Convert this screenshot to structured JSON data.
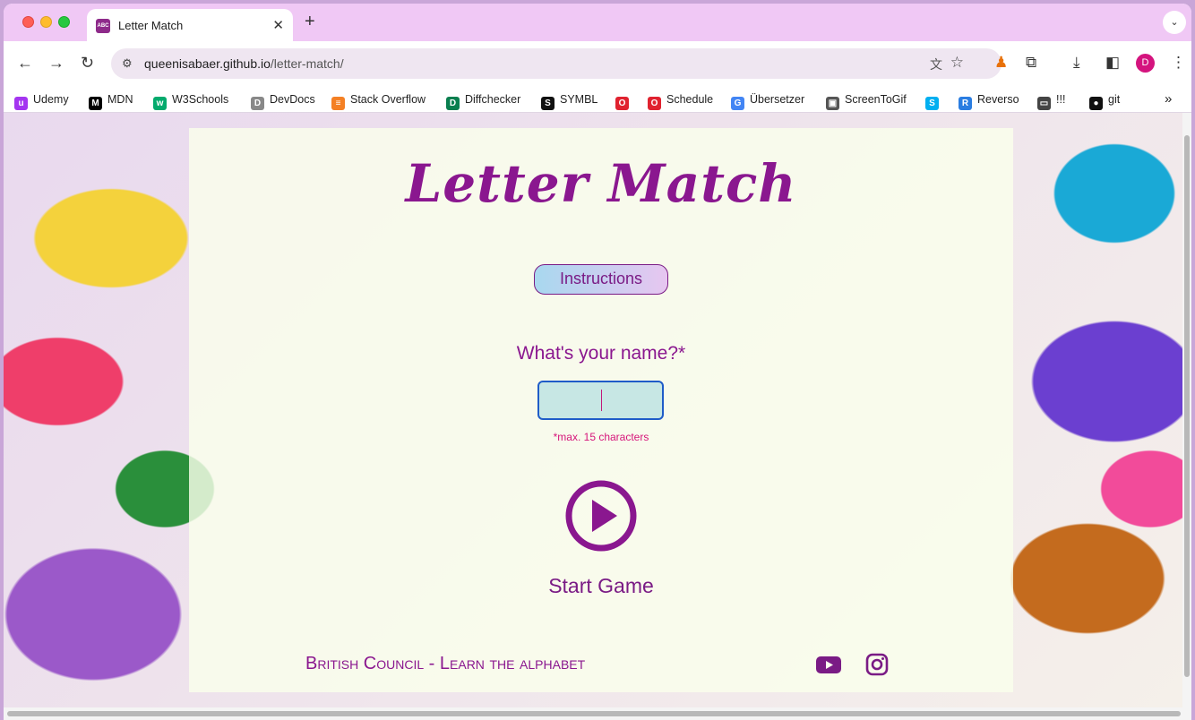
{
  "browser": {
    "tab_title": "Letter Match",
    "tab_favicon_text": "ABC",
    "new_tab": "+",
    "url_host": "queenisabaer.github.io",
    "url_path": "/letter-match/",
    "profile_initial": "D"
  },
  "bookmarks": [
    {
      "label": "Udemy",
      "icon": "udemy-icon",
      "color": "#a435f0"
    },
    {
      "label": "MDN",
      "icon": "mdn-icon",
      "color": "#000000"
    },
    {
      "label": "W3Schools",
      "icon": "w3schools-icon",
      "color": "#04aa6d"
    },
    {
      "label": "DevDocs",
      "icon": "devdocs-icon",
      "color": "#888888"
    },
    {
      "label": "Stack Overflow",
      "icon": "stackoverflow-icon",
      "color": "#f48024"
    },
    {
      "label": "Diffchecker",
      "icon": "diffchecker-icon",
      "color": "#0a7f4f"
    },
    {
      "label": "SYMBL",
      "icon": "symbl-icon",
      "color": "#111111"
    },
    {
      "label": "",
      "icon": "opera-icon",
      "color": "#e0222f"
    },
    {
      "label": "Schedule",
      "icon": "schedule-icon",
      "color": "#e0222f"
    },
    {
      "label": "Übersetzer",
      "icon": "translate-icon",
      "color": "#4285f4"
    },
    {
      "label": "ScreenToGif",
      "icon": "screentogif-icon",
      "color": "#555555"
    },
    {
      "label": "",
      "icon": "skype-icon",
      "color": "#00aff0"
    },
    {
      "label": "Reverso",
      "icon": "reverso-icon",
      "color": "#2a7de1"
    },
    {
      "label": "!!!",
      "icon": "folder-icon",
      "color": "#444444"
    },
    {
      "label": "git",
      "icon": "github-icon",
      "color": "#111111"
    }
  ],
  "page": {
    "title": "Letter Match",
    "instructions_label": "Instructions",
    "name_label": "What's your name?*",
    "name_value": "",
    "name_note": "*max. 15 characters",
    "start_label": "Start Game",
    "footer_credit": "British Council - Learn the alphabet",
    "social": [
      "youtube-icon",
      "instagram-icon"
    ],
    "accent_color": "#8a178f"
  }
}
